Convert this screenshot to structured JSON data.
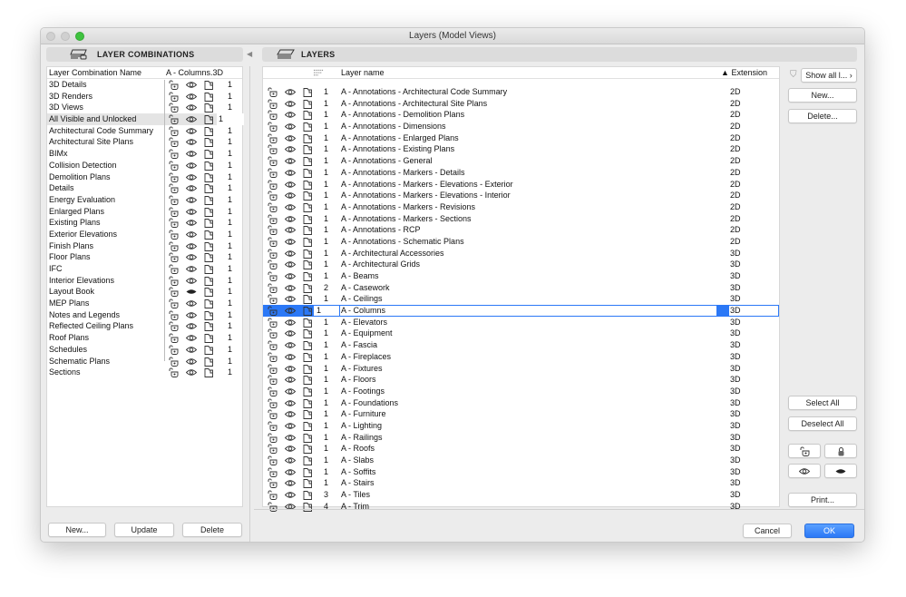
{
  "window": {
    "title": "Layers (Model Views)"
  },
  "left": {
    "header": "LAYER COMBINATIONS",
    "col_name": "Layer Combination Name",
    "col_state": "A - Columns.3D",
    "rows": [
      {
        "name": "3D Details",
        "eye": "open",
        "n": "1"
      },
      {
        "name": "3D Renders",
        "eye": "open",
        "n": "1"
      },
      {
        "name": "3D Views",
        "eye": "open",
        "n": "1"
      },
      {
        "name": "All Visible and Unlocked",
        "eye": "open",
        "n": "1",
        "selected": true
      },
      {
        "name": "Architectural Code Summary",
        "eye": "open",
        "n": "1"
      },
      {
        "name": "Architectural Site Plans",
        "eye": "open",
        "n": "1"
      },
      {
        "name": "BIMx",
        "eye": "open",
        "n": "1"
      },
      {
        "name": "Collision Detection",
        "eye": "open",
        "n": "1"
      },
      {
        "name": "Demolition Plans",
        "eye": "open",
        "n": "1"
      },
      {
        "name": "Details",
        "eye": "open",
        "n": "1"
      },
      {
        "name": "Energy Evaluation",
        "eye": "open",
        "n": "1"
      },
      {
        "name": "Enlarged Plans",
        "eye": "open",
        "n": "1"
      },
      {
        "name": "Existing Plans",
        "eye": "open",
        "n": "1"
      },
      {
        "name": "Exterior Elevations",
        "eye": "open",
        "n": "1"
      },
      {
        "name": "Finish Plans",
        "eye": "open",
        "n": "1"
      },
      {
        "name": "Floor Plans",
        "eye": "open",
        "n": "1"
      },
      {
        "name": "IFC",
        "eye": "open",
        "n": "1"
      },
      {
        "name": "Interior Elevations",
        "eye": "open",
        "n": "1"
      },
      {
        "name": "Layout Book",
        "eye": "closed",
        "n": "1"
      },
      {
        "name": "MEP Plans",
        "eye": "open",
        "n": "1"
      },
      {
        "name": "Notes and Legends",
        "eye": "open",
        "n": "1"
      },
      {
        "name": "Reflected Ceiling Plans",
        "eye": "open",
        "n": "1"
      },
      {
        "name": "Roof Plans",
        "eye": "open",
        "n": "1"
      },
      {
        "name": "Schedules",
        "eye": "open",
        "n": "1"
      },
      {
        "name": "Schematic Plans",
        "eye": "open",
        "n": "1"
      },
      {
        "name": "Sections",
        "eye": "open",
        "n": "1"
      }
    ],
    "buttons": {
      "new": "New...",
      "update": "Update",
      "delete": "Delete"
    }
  },
  "right": {
    "header": "LAYERS",
    "col_name": "Layer name",
    "col_ext": "Extension",
    "sort": "ascending",
    "rows": [
      {
        "n": "1",
        "name": "A - Annotations - Architectural Code Summary",
        "ext": "2D"
      },
      {
        "n": "1",
        "name": "A - Annotations - Architectural Site Plans",
        "ext": "2D"
      },
      {
        "n": "1",
        "name": "A - Annotations - Demolition Plans",
        "ext": "2D"
      },
      {
        "n": "1",
        "name": "A - Annotations - Dimensions",
        "ext": "2D"
      },
      {
        "n": "1",
        "name": "A - Annotations - Enlarged Plans",
        "ext": "2D"
      },
      {
        "n": "1",
        "name": "A - Annotations - Existing Plans",
        "ext": "2D"
      },
      {
        "n": "1",
        "name": "A - Annotations - General",
        "ext": "2D"
      },
      {
        "n": "1",
        "name": "A - Annotations - Markers - Details",
        "ext": "2D"
      },
      {
        "n": "1",
        "name": "A - Annotations - Markers - Elevations - Exterior",
        "ext": "2D"
      },
      {
        "n": "1",
        "name": "A - Annotations - Markers - Elevations - Interior",
        "ext": "2D"
      },
      {
        "n": "1",
        "name": "A - Annotations - Markers - Revisions",
        "ext": "2D"
      },
      {
        "n": "1",
        "name": "A - Annotations - Markers - Sections",
        "ext": "2D"
      },
      {
        "n": "1",
        "name": "A - Annotations - RCP",
        "ext": "2D"
      },
      {
        "n": "1",
        "name": "A - Annotations - Schematic Plans",
        "ext": "2D"
      },
      {
        "n": "1",
        "name": "A - Architectural Accessories",
        "ext": "3D"
      },
      {
        "n": "1",
        "name": "A - Architectural Grids",
        "ext": "3D"
      },
      {
        "n": "1",
        "name": "A - Beams",
        "ext": "3D"
      },
      {
        "n": "2",
        "name": "A - Casework",
        "ext": "3D"
      },
      {
        "n": "1",
        "name": "A - Ceilings",
        "ext": "3D"
      },
      {
        "n": "1",
        "name": "A - Columns",
        "ext": "3D",
        "selected": true
      },
      {
        "n": "1",
        "name": "A - Elevators",
        "ext": "3D"
      },
      {
        "n": "1",
        "name": "A - Equipment",
        "ext": "3D"
      },
      {
        "n": "1",
        "name": "A - Fascia",
        "ext": "3D"
      },
      {
        "n": "1",
        "name": "A - Fireplaces",
        "ext": "3D"
      },
      {
        "n": "1",
        "name": "A - Fixtures",
        "ext": "3D"
      },
      {
        "n": "1",
        "name": "A - Floors",
        "ext": "3D"
      },
      {
        "n": "1",
        "name": "A - Footings",
        "ext": "3D"
      },
      {
        "n": "1",
        "name": "A - Foundations",
        "ext": "3D"
      },
      {
        "n": "1",
        "name": "A - Furniture",
        "ext": "3D"
      },
      {
        "n": "1",
        "name": "A - Lighting",
        "ext": "3D"
      },
      {
        "n": "1",
        "name": "A - Railings",
        "ext": "3D"
      },
      {
        "n": "1",
        "name": "A - Roofs",
        "ext": "3D"
      },
      {
        "n": "1",
        "name": "A - Slabs",
        "ext": "3D"
      },
      {
        "n": "1",
        "name": "A - Soffits",
        "ext": "3D"
      },
      {
        "n": "1",
        "name": "A - Stairs",
        "ext": "3D"
      },
      {
        "n": "3",
        "name": "A - Tiles",
        "ext": "3D"
      },
      {
        "n": "4",
        "name": "A - Trim",
        "ext": "3D"
      }
    ],
    "buttons": {
      "show_all": "Show all l...",
      "new": "New...",
      "delete": "Delete...",
      "select_all": "Select All",
      "deselect_all": "Deselect All",
      "print": "Print...",
      "cancel": "Cancel",
      "ok": "OK"
    }
  },
  "colors": {
    "accent": "#2b78f6",
    "close_dot": "#d0d0d0",
    "zoom_dot": "#3fc33f"
  }
}
